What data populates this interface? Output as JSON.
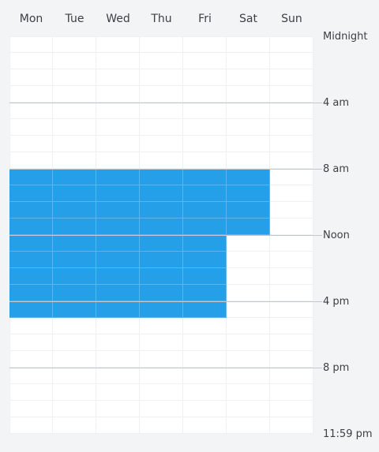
{
  "days": [
    "Mon",
    "Tue",
    "Wed",
    "Thu",
    "Fri",
    "Sat",
    "Sun"
  ],
  "time_labels": [
    "Midnight",
    "4 am",
    "8 am",
    "Noon",
    "4 pm",
    "8 pm",
    "11:59 pm"
  ],
  "accent_color": "#25a0e8",
  "schedule": {
    "Mon": {
      "selected_start_hour": 8,
      "selected_end_hour": 17
    },
    "Tue": {
      "selected_start_hour": 8,
      "selected_end_hour": 17
    },
    "Wed": {
      "selected_start_hour": 8,
      "selected_end_hour": 17
    },
    "Thu": {
      "selected_start_hour": 8,
      "selected_end_hour": 17
    },
    "Fri": {
      "selected_start_hour": 8,
      "selected_end_hour": 17
    },
    "Sat": {
      "selected_start_hour": 8,
      "selected_end_hour": 12
    },
    "Sun": null
  }
}
